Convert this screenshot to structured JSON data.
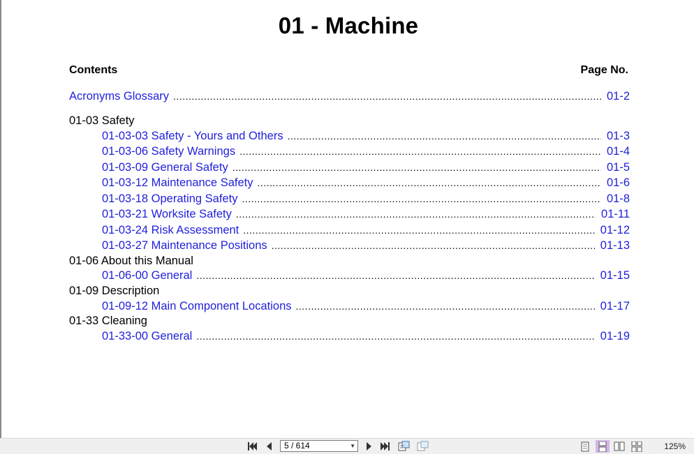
{
  "document": {
    "title": "01 - Machine",
    "contents_label": "Contents",
    "page_no_label": "Page No."
  },
  "toc": [
    {
      "type": "link",
      "indent": false,
      "label": "Acronyms Glossary",
      "page": "01-2"
    },
    {
      "type": "section",
      "label": "01-03 Safety"
    },
    {
      "type": "link",
      "indent": true,
      "label": "01-03-03 Safety - Yours and Others",
      "page": "01-3"
    },
    {
      "type": "link",
      "indent": true,
      "label": "01-03-06 Safety Warnings",
      "page": "01-4"
    },
    {
      "type": "link",
      "indent": true,
      "label": "01-03-09 General Safety",
      "page": "01-5"
    },
    {
      "type": "link",
      "indent": true,
      "label": "01-03-12 Maintenance Safety",
      "page": "01-6"
    },
    {
      "type": "link",
      "indent": true,
      "label": "01-03-18 Operating Safety",
      "page": "01-8"
    },
    {
      "type": "link",
      "indent": true,
      "label": "01-03-21 Worksite Safety",
      "page": "01-11"
    },
    {
      "type": "link",
      "indent": true,
      "label": "01-03-24 Risk Assessment",
      "page": "01-12"
    },
    {
      "type": "link",
      "indent": true,
      "label": "01-03-27 Maintenance Positions",
      "page": "01-13"
    },
    {
      "type": "section",
      "label": "01-06 About this Manual"
    },
    {
      "type": "link",
      "indent": true,
      "label": "01-06-00 General",
      "page": "01-15"
    },
    {
      "type": "section",
      "label": "01-09 Description"
    },
    {
      "type": "link",
      "indent": true,
      "label": "01-09-12 Main Component Locations",
      "page": "01-17"
    },
    {
      "type": "section",
      "label": "01-33 Cleaning"
    },
    {
      "type": "link",
      "indent": true,
      "label": "01-33-00 General",
      "page": "01-19"
    }
  ],
  "toolbar": {
    "page_indicator": "5 / 614",
    "zoom": "125%",
    "icons": [
      "first-page-icon",
      "previous-page-icon",
      "next-page-icon",
      "last-page-icon",
      "fit-page-icon",
      "fit-width-icon",
      "single-page-view-icon",
      "continuous-view-icon",
      "two-page-view-icon",
      "two-page-continuous-view-icon"
    ]
  },
  "colors": {
    "link": "#1f1fdc",
    "toolbar_bg": "#f0f0f0",
    "selected_view": "#d4b8e6"
  }
}
